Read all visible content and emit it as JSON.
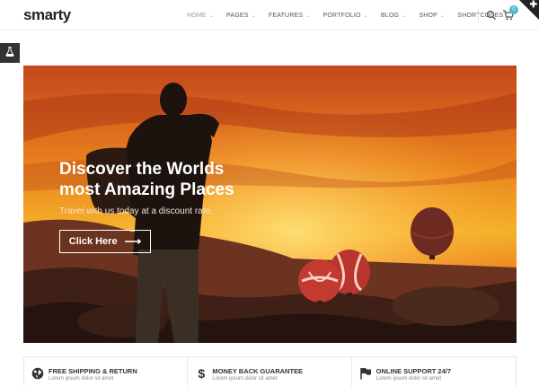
{
  "header": {
    "logo": "smarty",
    "nav": [
      {
        "label": "HOME",
        "active": true
      },
      {
        "label": "PAGES",
        "active": false
      },
      {
        "label": "FEATURES",
        "active": false
      },
      {
        "label": "PORTFOLIO",
        "active": false
      },
      {
        "label": "BLOG",
        "active": false
      },
      {
        "label": "SHOP",
        "active": false
      },
      {
        "label": "SHORTCODES",
        "active": false
      }
    ],
    "cart_count": "0",
    "icons": [
      "search-icon",
      "cart-icon",
      "plus-icon"
    ]
  },
  "side_tab": {
    "icon": "flask-icon"
  },
  "hero": {
    "title_line1": "Discover the Worlds",
    "title_line2": "most Amazing Places",
    "subtitle": "Travel with us today at a discount rate.",
    "button_label": "Click Here",
    "button_icon": "arrow-right-icon"
  },
  "features": [
    {
      "icon": "globe-icon",
      "title": "FREE SHIPPING & RETURN",
      "subtitle": "Lorem ipsum dolor sit amet"
    },
    {
      "icon": "dollar-icon",
      "title": "MONEY BACK GUARANTEE",
      "subtitle": "Lorem ipsum dolor sit amet"
    },
    {
      "icon": "flag-icon",
      "title": "ONLINE SUPPORT 24/7",
      "subtitle": "Lorem ipsum dolor sit amet"
    }
  ],
  "colors": {
    "accent": "#4fb6c7",
    "dark": "#333333"
  }
}
